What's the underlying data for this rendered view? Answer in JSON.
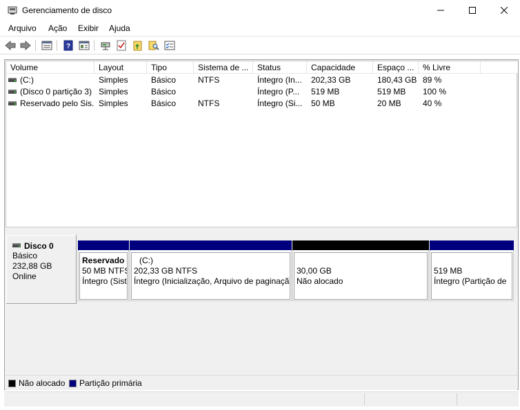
{
  "window": {
    "title": "Gerenciamento de disco",
    "minimize_icon": "minimize-icon",
    "maximize_icon": "maximize-icon",
    "close_icon": "close-icon"
  },
  "menu": {
    "items": [
      "Arquivo",
      "Ação",
      "Exibir",
      "Ajuda"
    ]
  },
  "toolbar": {
    "icons": [
      "back-arrow-icon",
      "forward-arrow-icon",
      "list-view-icon",
      "help-icon",
      "details-pane-icon",
      "connect-icon",
      "check-icon",
      "folder-up-icon",
      "search-icon",
      "properties-icon"
    ]
  },
  "volume_list": {
    "columns": [
      "Volume",
      "Layout",
      "Tipo",
      "Sistema de ...",
      "Status",
      "Capacidade",
      "Espaço ...",
      "% Livre"
    ],
    "rows": [
      {
        "volume": "(C:)",
        "layout": "Simples",
        "tipo": "Básico",
        "sistema": "NTFS",
        "status": "Íntegro (In...",
        "capacidade": "202,33 GB",
        "espaco": "180,43 GB",
        "livre": "89 %"
      },
      {
        "volume": "(Disco 0 partição 3)",
        "layout": "Simples",
        "tipo": "Básico",
        "sistema": "",
        "status": "Íntegro (P...",
        "capacidade": "519 MB",
        "espaco": "519 MB",
        "livre": "100 %"
      },
      {
        "volume": "Reservado pelo Sis...",
        "layout": "Simples",
        "tipo": "Básico",
        "sistema": "NTFS",
        "status": "Íntegro (Si...",
        "capacidade": "50 MB",
        "espaco": "20 MB",
        "livre": "40 %"
      }
    ]
  },
  "disk": {
    "name": "Disco 0",
    "type": "Básico",
    "size": "232,88 GB",
    "state": "Online",
    "partitions": [
      {
        "title": "Reservado",
        "line1": "50 MB NTFS",
        "line2": "Íntegro (Sist",
        "kind": "primary"
      },
      {
        "title": "(C:)",
        "line1": "202,33 GB NTFS",
        "line2": "Íntegro (Inicialização, Arquivo de paginação",
        "kind": "primary"
      },
      {
        "title": "",
        "line1": "30,00 GB",
        "line2": "Não alocado",
        "kind": "unallocated"
      },
      {
        "title": "",
        "line1": "519 MB",
        "line2": "Íntegro (Partição de",
        "kind": "primary"
      }
    ]
  },
  "legend": {
    "unallocated": "Não alocado",
    "primary": "Partição primária"
  },
  "colors": {
    "primary_partition": "#00007f",
    "unallocated": "#000000"
  }
}
